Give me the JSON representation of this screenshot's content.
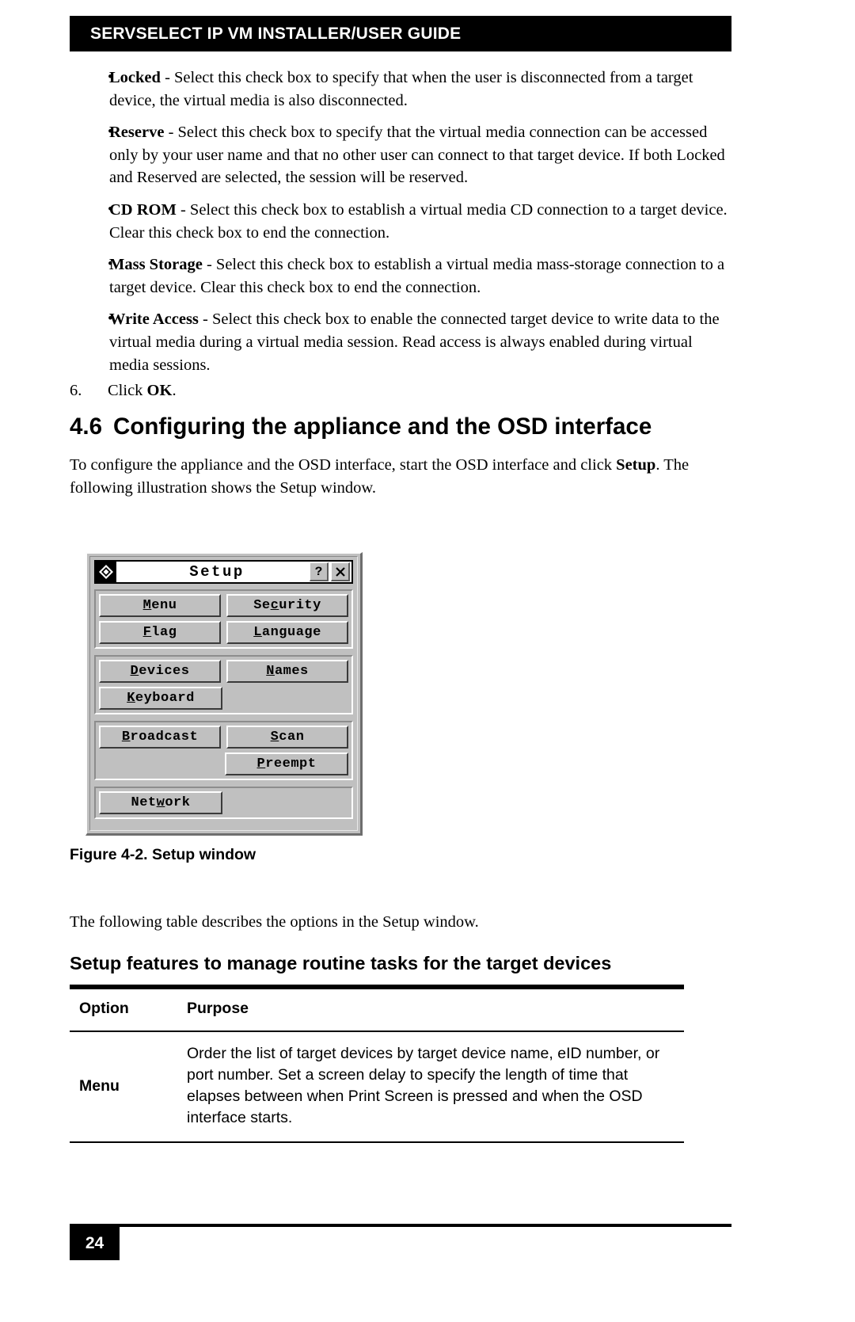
{
  "header": {
    "title": "SERVSELECT IP VM INSTALLER/USER GUIDE"
  },
  "bullets": [
    {
      "marker": "•",
      "term": "Locked",
      "text": " - Select this check box to specify that when the user is disconnected from a target device, the virtual media is also disconnected."
    },
    {
      "marker": "•",
      "term": "Reserve",
      "text": " - Select this check box to specify that the virtual media connection can be accessed only by your user name and that no other user can connect to that target device. If both Locked and Reserved are selected, the session will be reserved."
    },
    {
      "marker": "•",
      "term": "CD ROM",
      "text": " - Select this check box to establish a virtual media CD connection to a target device. Clear this check box to end the connection."
    },
    {
      "marker": "•",
      "term": "Mass Storage",
      "text": " - Select this check box to establish a virtual media mass-storage connection to a target device. Clear this check box to end the connection."
    },
    {
      "marker": "•",
      "term": "Write Access",
      "text": " - Select this check box to enable the connected target device to write data to the virtual media during a virtual media session. Read access is always enabled during virtual media sessions."
    }
  ],
  "step": {
    "number": "6.",
    "prefix": "Click ",
    "bold": "OK",
    "suffix": "."
  },
  "section": {
    "number": "4.6",
    "title": "Configuring the appliance and the OSD interface"
  },
  "intro": {
    "part1": "To configure the appliance and the OSD interface, start the OSD interface and click ",
    "bold": "Setup",
    "part2": ". The following illustration shows the Setup window."
  },
  "osd_window": {
    "title": "Setup",
    "icon": "diamond-logo-icon",
    "help_button": "?",
    "close_button": "✕",
    "groups": [
      {
        "rows": [
          [
            {
              "label": "Menu",
              "accel": "M",
              "accel_index": 0
            },
            {
              "label": "Security",
              "accel": "c",
              "accel_index": 2
            }
          ],
          [
            {
              "label": "Flag",
              "accel": "F",
              "accel_index": 0
            },
            {
              "label": "Language",
              "accel": "L",
              "accel_index": 0
            }
          ]
        ]
      },
      {
        "rows": [
          [
            {
              "label": "Devices",
              "accel": "D",
              "accel_index": 0
            },
            {
              "label": "Names",
              "accel": "N",
              "accel_index": 0
            }
          ],
          [
            {
              "label": "Keyboard",
              "accel": "K",
              "accel_index": 0
            },
            null
          ]
        ]
      },
      {
        "rows": [
          [
            {
              "label": "Broadcast",
              "accel": "B",
              "accel_index": 0
            },
            {
              "label": "Scan",
              "accel": "S",
              "accel_index": 0
            }
          ],
          [
            null,
            {
              "label": "Preempt",
              "accel": "P",
              "accel_index": 0
            }
          ]
        ]
      },
      {
        "rows": [
          [
            {
              "label": "Network",
              "accel": "w",
              "accel_index": 3
            },
            null
          ]
        ]
      }
    ]
  },
  "figure": {
    "caption": "Figure 4-2.  Setup window"
  },
  "follow_text": "The following table describes the options in the Setup window.",
  "table": {
    "title": "Setup features to manage routine tasks for the target devices",
    "columns": [
      "Option",
      "Purpose"
    ],
    "rows": [
      {
        "option": "Menu",
        "purpose": "Order the list of target devices by target device name, eID number, or port number. Set a screen delay to specify the length of time that elapses between when Print Screen is pressed and when the OSD interface starts."
      }
    ]
  },
  "footer": {
    "page_number": "24"
  }
}
